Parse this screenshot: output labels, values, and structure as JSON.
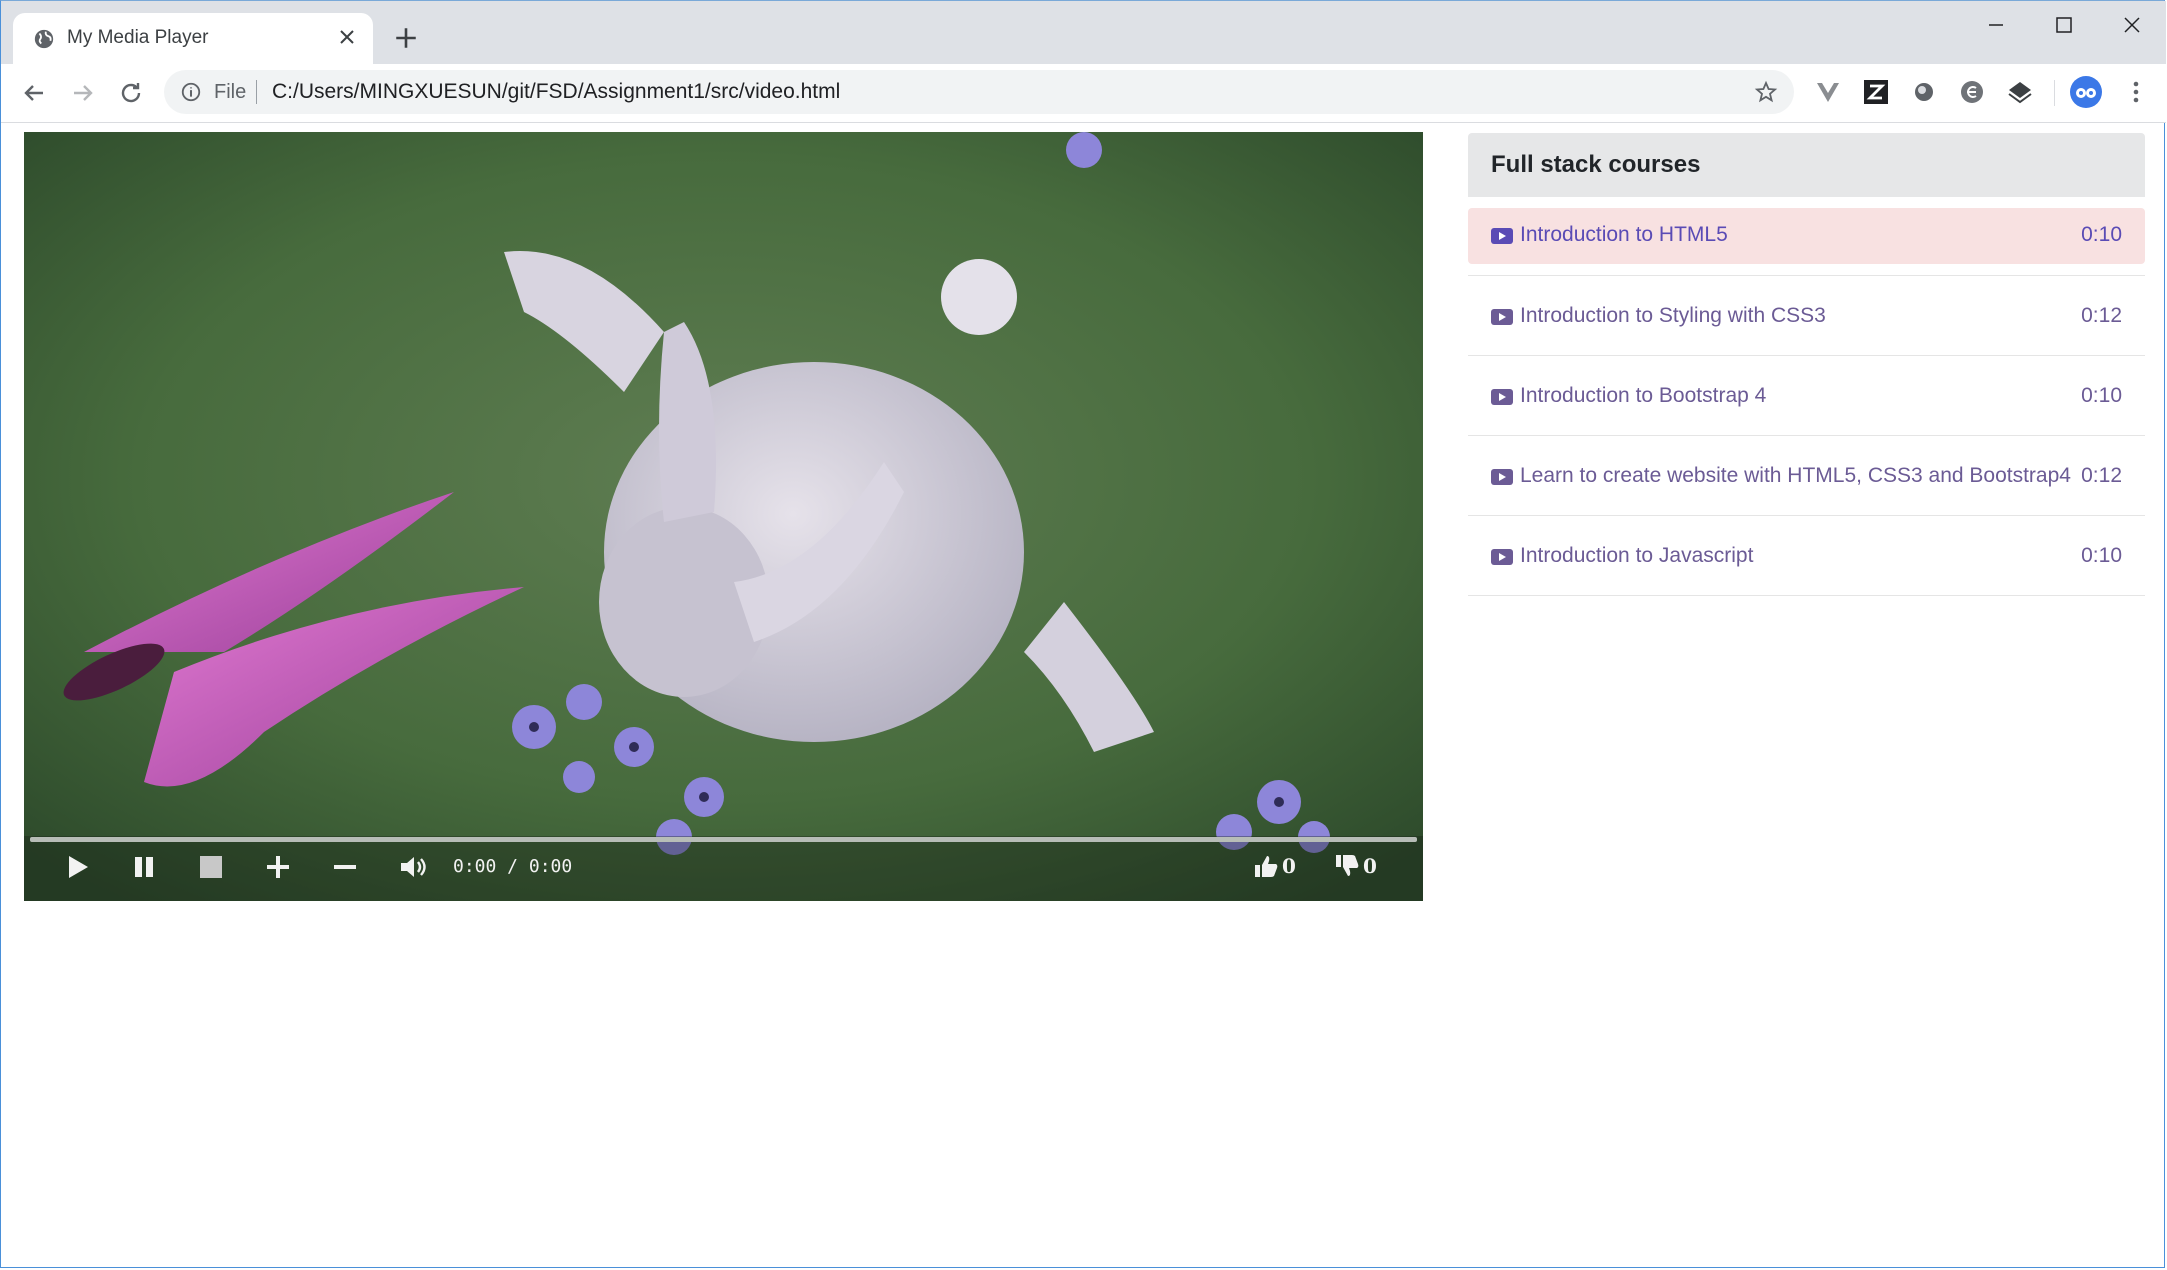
{
  "browser": {
    "tab_title": "My Media Player",
    "file_label": "File",
    "url": "C:/Users/MINGXUESUN/git/FSD/Assignment1/src/video.html"
  },
  "player": {
    "time_display": "0:00 / 0:00",
    "likes": "0",
    "dislikes": "0",
    "progress_fraction": 0
  },
  "sidebar": {
    "title": "Full stack courses",
    "courses": [
      {
        "label": "Introduction to HTML5",
        "duration": "0:10"
      },
      {
        "label": "Introduction to Styling with CSS3",
        "duration": "0:12"
      },
      {
        "label": "Introduction to Bootstrap 4",
        "duration": "0:10"
      },
      {
        "label": "Learn to create website with HTML5, CSS3 and Bootstrap4",
        "duration": "0:12"
      },
      {
        "label": "Introduction to Javascript",
        "duration": "0:10"
      }
    ]
  },
  "colors": {
    "active_row_bg": "#f8e1e1",
    "link": "#6b5b95",
    "header_bg": "#e6e7e8"
  }
}
